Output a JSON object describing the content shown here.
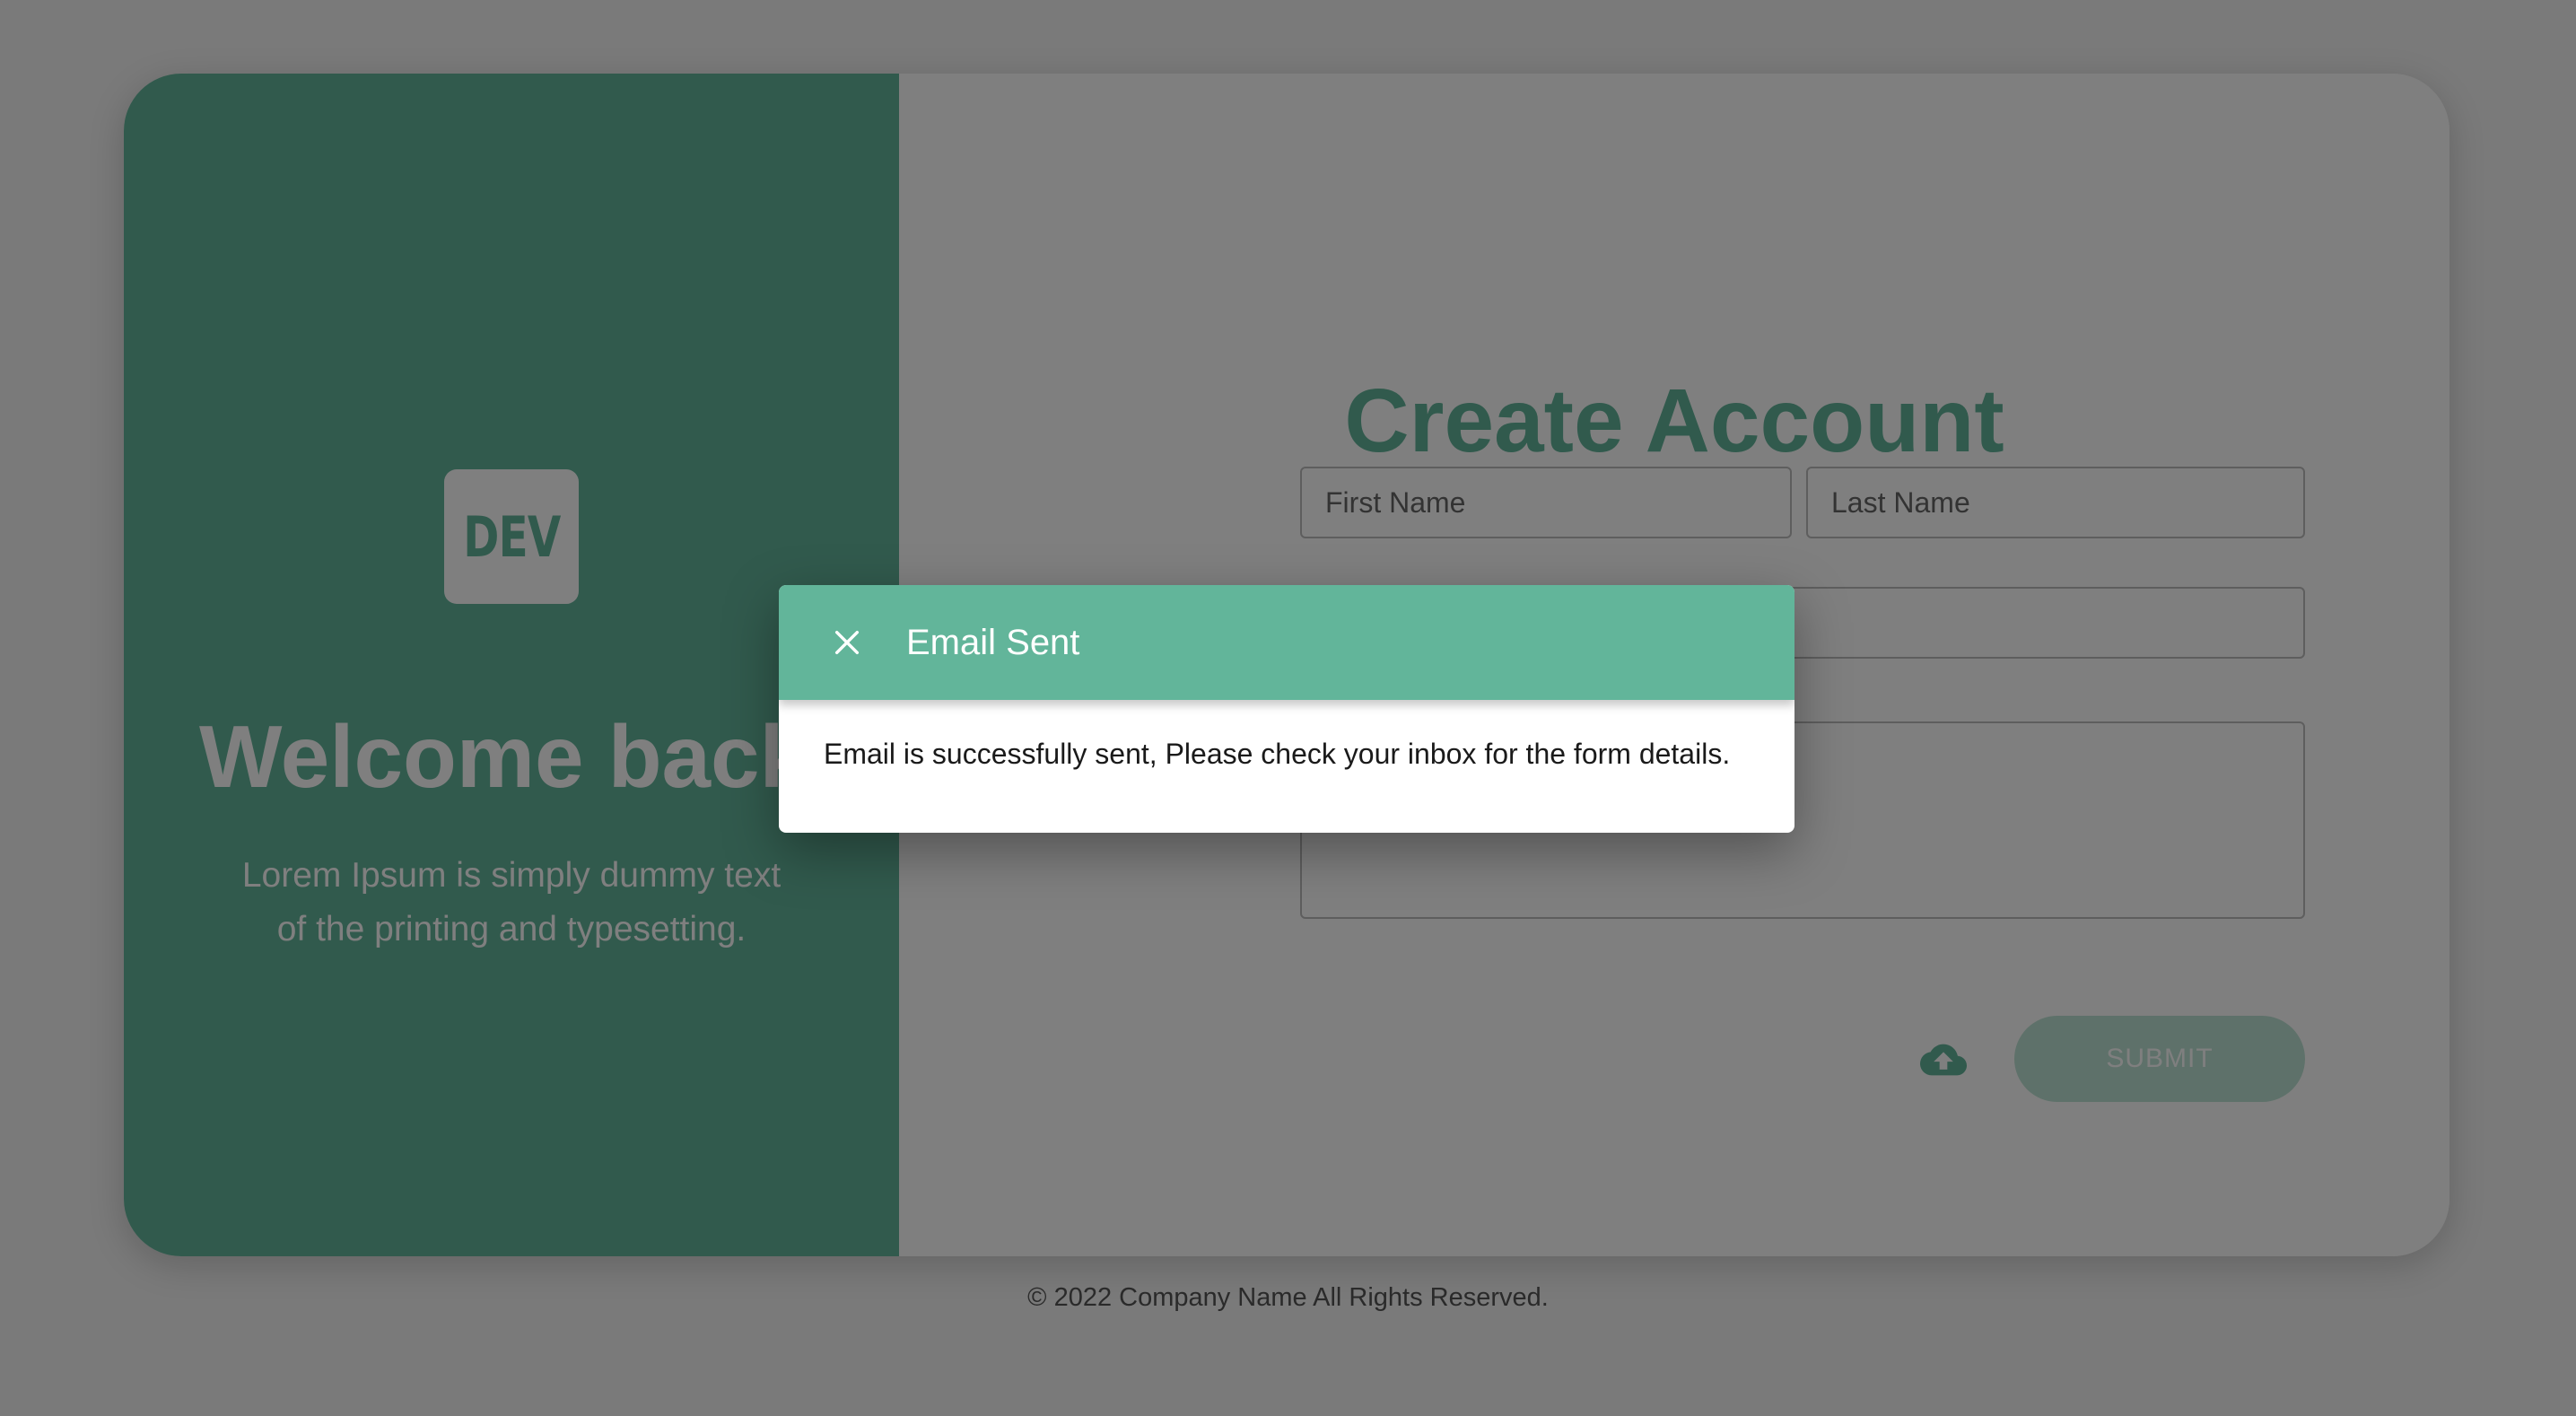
{
  "left_panel": {
    "logo_text": "DEV",
    "welcome": "Welcome back",
    "lorem": "Lorem Ipsum is simply dummy text\nof the printing and typesetting."
  },
  "form": {
    "title": "Create Account",
    "first_name_placeholder": "First Name",
    "last_name_placeholder": "Last Name",
    "email_placeholder": "",
    "message_placeholder": "",
    "upload_icon": "cloud-upload-icon",
    "submit_label": "SUBMIT"
  },
  "footer": {
    "text": "© 2022 Company Name All Rights Reserved."
  },
  "dialog": {
    "title": "Email Sent",
    "message": "Email is successfully sent, Please check your inbox for the form details.",
    "close_icon": "close-icon"
  },
  "colors": {
    "brand": "#62b59a",
    "overlay": "rgba(0,0,0,0.5)",
    "submit_disabled": "#bde3d4"
  }
}
